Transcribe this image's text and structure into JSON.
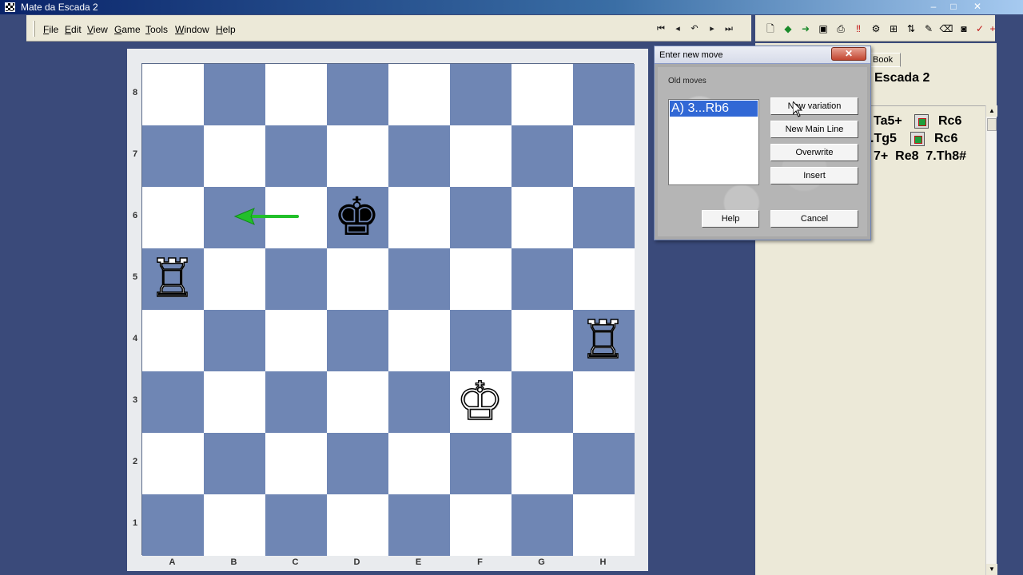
{
  "window": {
    "title": "Mate da Escada 2",
    "minimize": "–",
    "maximize": "□",
    "close": "✕"
  },
  "menu": {
    "file": "File",
    "edit": "Edit",
    "view": "View",
    "game": "Game",
    "tools": "Tools",
    "window": "Window",
    "help": "Help"
  },
  "nav_icons": [
    "first-move-icon",
    "previous-move-icon",
    "undo-icon",
    "next-move-icon",
    "last-move-icon"
  ],
  "board": {
    "ranks": [
      "8",
      "7",
      "6",
      "5",
      "4",
      "3",
      "2",
      "1"
    ],
    "files": [
      "A",
      "B",
      "C",
      "D",
      "E",
      "F",
      "G",
      "H"
    ],
    "light_color": "#ffffff",
    "dark_color": "#6f86b4",
    "pieces": [
      {
        "square": "d6",
        "piece": "king",
        "color": "black"
      },
      {
        "square": "a5",
        "piece": "rook",
        "color": "white"
      },
      {
        "square": "h4",
        "piece": "rook",
        "color": "white"
      },
      {
        "square": "f3",
        "piece": "king",
        "color": "white"
      }
    ],
    "arrow": {
      "from": "c6",
      "to": "b6",
      "color": "#22c02a"
    }
  },
  "notation": {
    "tab_label": "Book",
    "game_title": "Escada 2",
    "lines": [
      {
        "a": "Ta5+",
        "b": "Rc6"
      },
      {
        "a": ".Tg5",
        "b": "Rc6"
      },
      {
        "a": "7+  Re8  7.Th8#",
        "b": ""
      }
    ]
  },
  "dialog": {
    "title": "Enter new move",
    "close": "✕",
    "old_moves_label": "Old moves",
    "old_moves": [
      "A) 3...Rb6"
    ],
    "buttons": {
      "new_variation": "New variation",
      "new_main_line": "New Main Line",
      "overwrite": "Overwrite",
      "insert": "Insert",
      "help": "Help",
      "cancel": "Cancel"
    }
  }
}
